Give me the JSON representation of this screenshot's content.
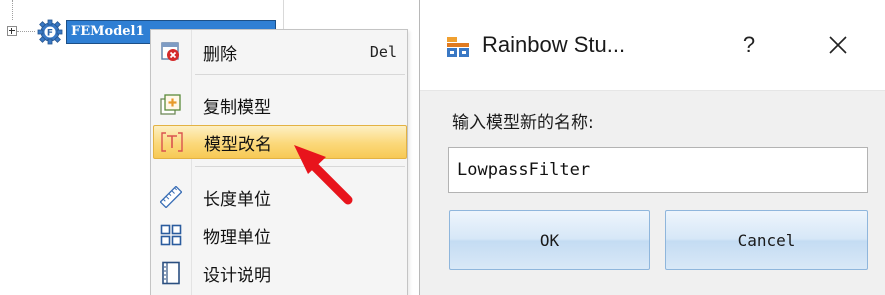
{
  "tree": {
    "node_label": "FEModel1",
    "node_icon": "gear-node-icon",
    "expander_state": "collapsed"
  },
  "context_menu": {
    "items": [
      {
        "label": "删除",
        "shortcut": "Del",
        "icon": "delete-icon"
      },
      {
        "label": "复制模型",
        "shortcut": "",
        "icon": "copy-model-icon"
      },
      {
        "label": "模型改名",
        "shortcut": "",
        "icon": "rename-icon",
        "highlighted": true
      },
      {
        "label": "长度单位",
        "shortcut": "",
        "icon": "ruler-icon"
      },
      {
        "label": "物理单位",
        "shortcut": "",
        "icon": "grid-units-icon"
      },
      {
        "label": "设计说明",
        "shortcut": "",
        "icon": "document-icon"
      }
    ]
  },
  "dialog": {
    "title": "Rainbow Stu...",
    "help_label": "?",
    "prompt": "输入模型新的名称:",
    "input_value": "LowpassFilter",
    "ok_label": "OK",
    "cancel_label": "Cancel"
  },
  "colors": {
    "selection_blue": "#2f7fd4",
    "menu_highlight": "#fbd87a",
    "button_border": "#8fb6dc",
    "arrow_red": "#e8141c",
    "delete_red": "#d42a2a",
    "copy_orange": "#e89a2a"
  }
}
